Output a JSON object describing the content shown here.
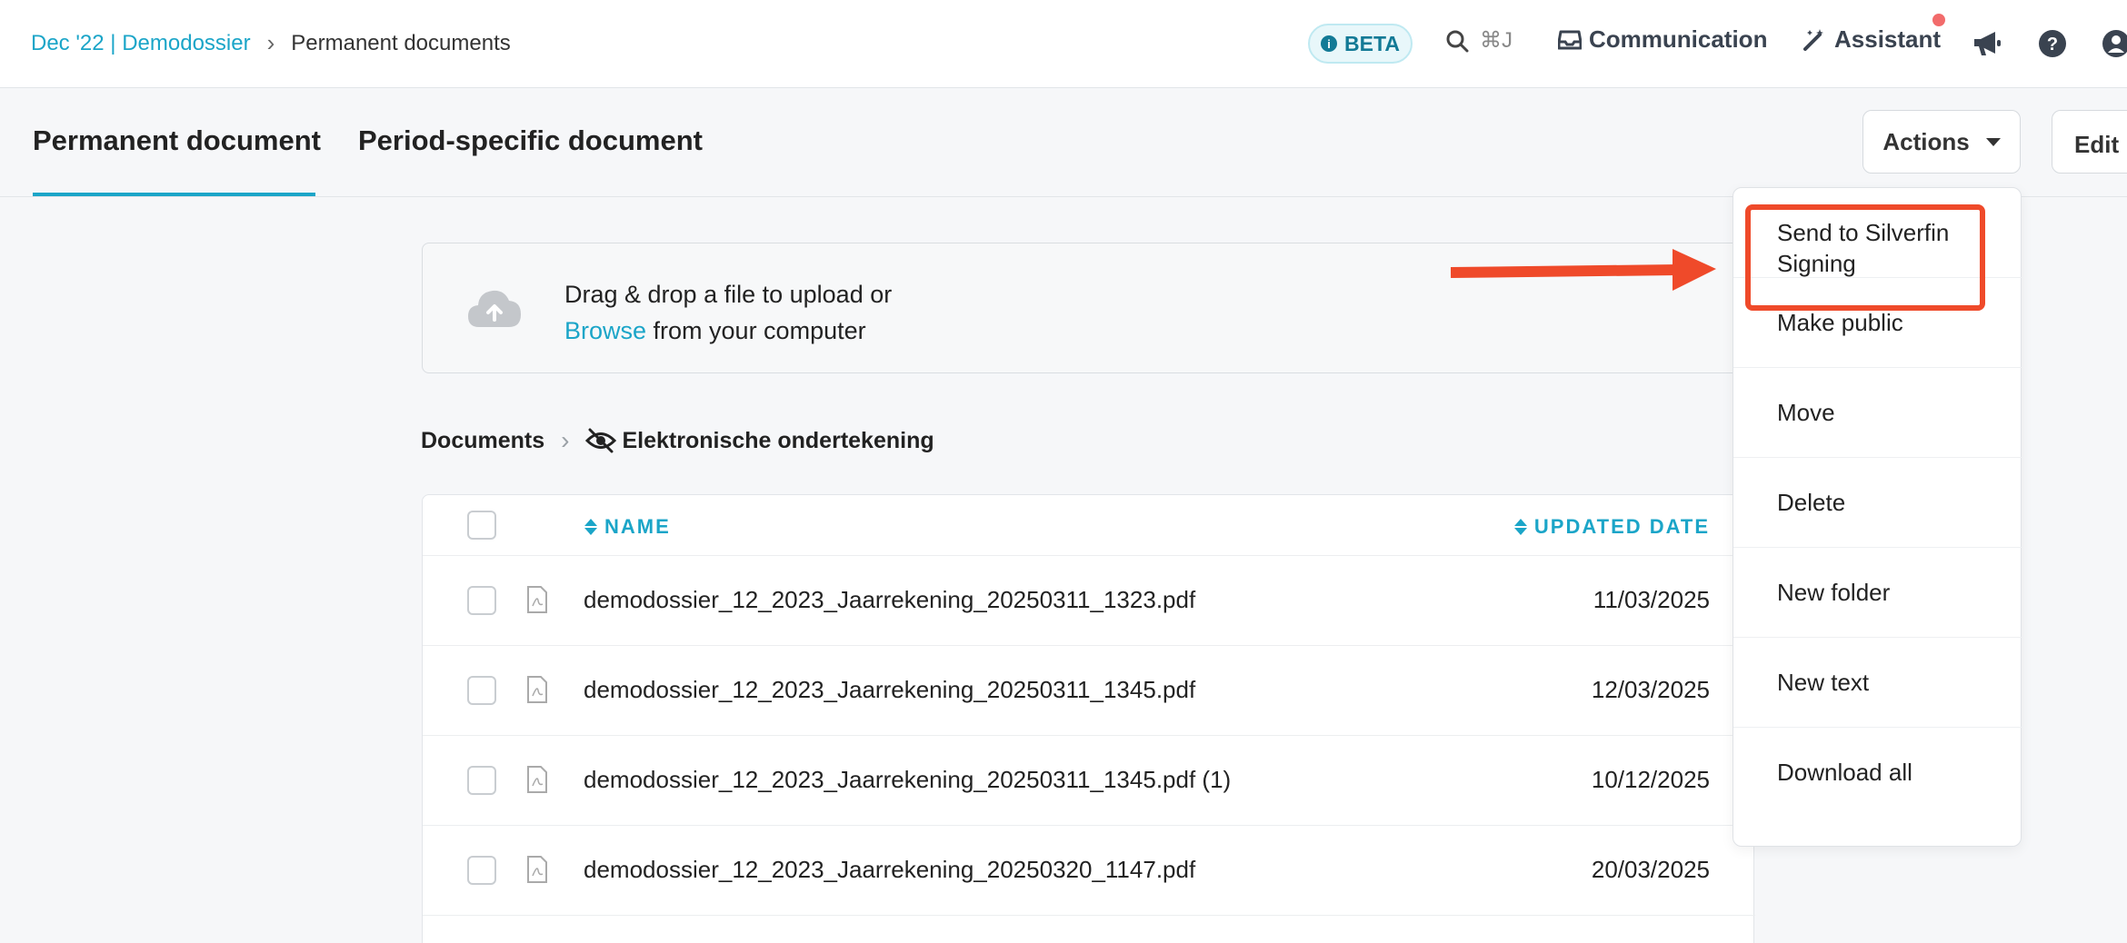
{
  "breadcrumb": {
    "parent": "Dec '22 | Demodossier",
    "current": "Permanent documents"
  },
  "topbar": {
    "beta_label": "BETA",
    "search_shortcut": "⌘J",
    "communication_label": "Communication",
    "assistant_label": "Assistant"
  },
  "tabs": {
    "permanent": "Permanent document",
    "period_specific": "Period-specific document"
  },
  "actions": {
    "label": "Actions",
    "edit_label": "Edit"
  },
  "upload": {
    "line1": "Drag & drop a file to upload or",
    "browse": "Browse",
    "line2_rest": " from your computer"
  },
  "path": {
    "root": "Documents",
    "folder": "Elektronische ondertekening"
  },
  "table": {
    "col_name": "NAME",
    "col_updated": "UPDATED DATE",
    "rows": [
      {
        "name": "demodossier_12_2023_Jaarrekening_20250311_1323.pdf",
        "date": "11/03/2025"
      },
      {
        "name": "demodossier_12_2023_Jaarrekening_20250311_1345.pdf",
        "date": "12/03/2025"
      },
      {
        "name": "demodossier_12_2023_Jaarrekening_20250311_1345.pdf (1)",
        "date": "10/12/2025"
      },
      {
        "name": "demodossier_12_2023_Jaarrekening_20250320_1147.pdf",
        "date": "20/03/2025"
      }
    ]
  },
  "menu": {
    "items": [
      "Send to Silverfin Signing",
      "Make public",
      "Move",
      "Delete",
      "New folder",
      "New text",
      "Download all"
    ]
  },
  "colors": {
    "accent": "#1ba5c8",
    "annotation": "#ef4a2a",
    "notification_dot": "#f26b6b"
  },
  "icons": [
    "chevron-right-icon",
    "info-icon",
    "search-icon",
    "inbox-icon",
    "magic-wand-icon",
    "megaphone-icon",
    "help-icon",
    "user-icon",
    "caret-down-icon",
    "cloud-upload-icon",
    "eye-slash-icon",
    "sort-icon",
    "pdf-file-icon"
  ]
}
